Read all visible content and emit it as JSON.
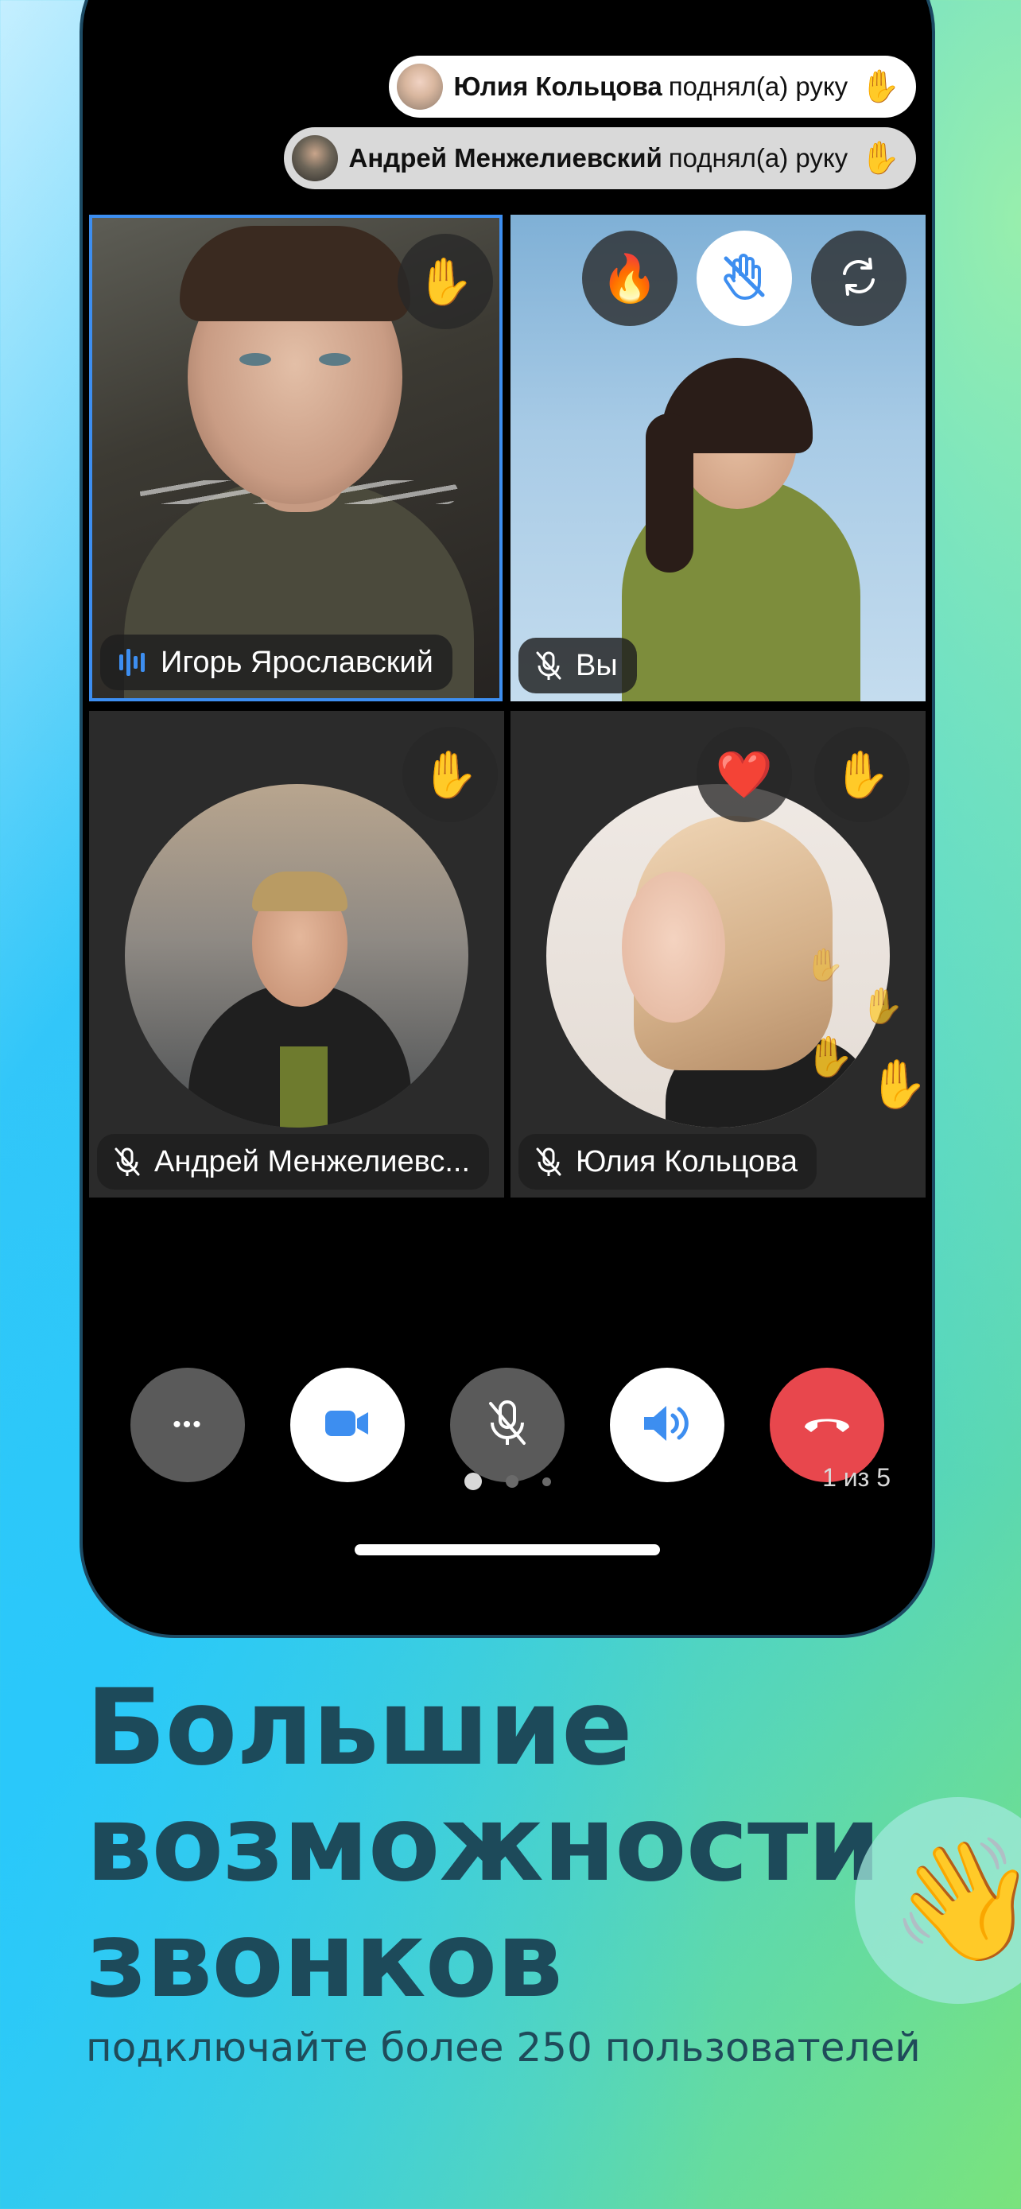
{
  "notifications": [
    {
      "name": "Юлия Кольцова",
      "action": "поднял(а) руку",
      "icon": "raised-hand-emoji"
    },
    {
      "name": "Андрей Менжелиевский",
      "action": "поднял(а) руку",
      "icon": "raised-hand-emoji"
    }
  ],
  "emoji": {
    "hand": "✋",
    "fire": "🔥",
    "heart": "❤️",
    "wave": "👋"
  },
  "tiles": {
    "t1": {
      "name": "Игорь Ярославский",
      "status": "speaking",
      "icon": "voice-wave-icon"
    },
    "t2": {
      "name": "Вы",
      "status": "muted",
      "icon": "mic-off-icon"
    },
    "t3": {
      "name": "Андрей Менжелиевс...",
      "status": "muted",
      "icon": "mic-off-icon"
    },
    "t4": {
      "name": "Юлия Кольцова",
      "status": "muted",
      "icon": "mic-off-icon"
    }
  },
  "controls": {
    "more_label": "•••",
    "items": [
      "more-button",
      "camera-button",
      "mic-button",
      "speaker-button",
      "end-call-button"
    ]
  },
  "pager": {
    "text": "1 из 5",
    "current": 1,
    "total": 5
  },
  "marketing": {
    "headline_line1": "Большие",
    "headline_line2": "возможности",
    "headline_line3": "звонков",
    "subtitle": "подключайте более 250 пользователей"
  },
  "colors": {
    "accent_blue": "#3d8ef0",
    "end_call_red": "#e8474d",
    "headline": "#1d4a5a"
  }
}
